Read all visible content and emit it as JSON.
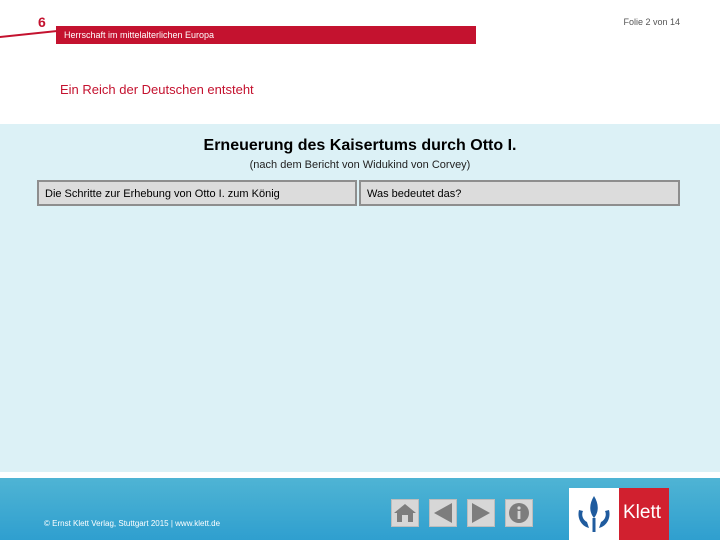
{
  "header": {
    "chapter_number": "6",
    "slide_counter": "Folie 2 von 14",
    "topic": "Herrschaft im mittelalterlichen Europa",
    "subtitle": "Ein Reich der Deutschen entsteht"
  },
  "main": {
    "title": "Erneuerung des Kaisertums durch Otto I.",
    "source_note": "(nach dem Bericht von Widukind von Corvey)",
    "columns": [
      {
        "label": "Die Schritte zur Erhebung von Otto I. zum König"
      },
      {
        "label": "Was bedeutet das?"
      }
    ]
  },
  "footer": {
    "copyright": "© Ernst Klett Verlag, Stuttgart 2015 | www.klett.de",
    "nav": [
      {
        "icon": "home-icon"
      },
      {
        "icon": "previous-icon"
      },
      {
        "icon": "next-icon"
      },
      {
        "icon": "info-icon"
      }
    ],
    "logo_text": "Klett"
  },
  "colors": {
    "brand_red": "#c4122f",
    "content_bg": "#dcf1f6",
    "footer_blue": "#36a6d2"
  }
}
